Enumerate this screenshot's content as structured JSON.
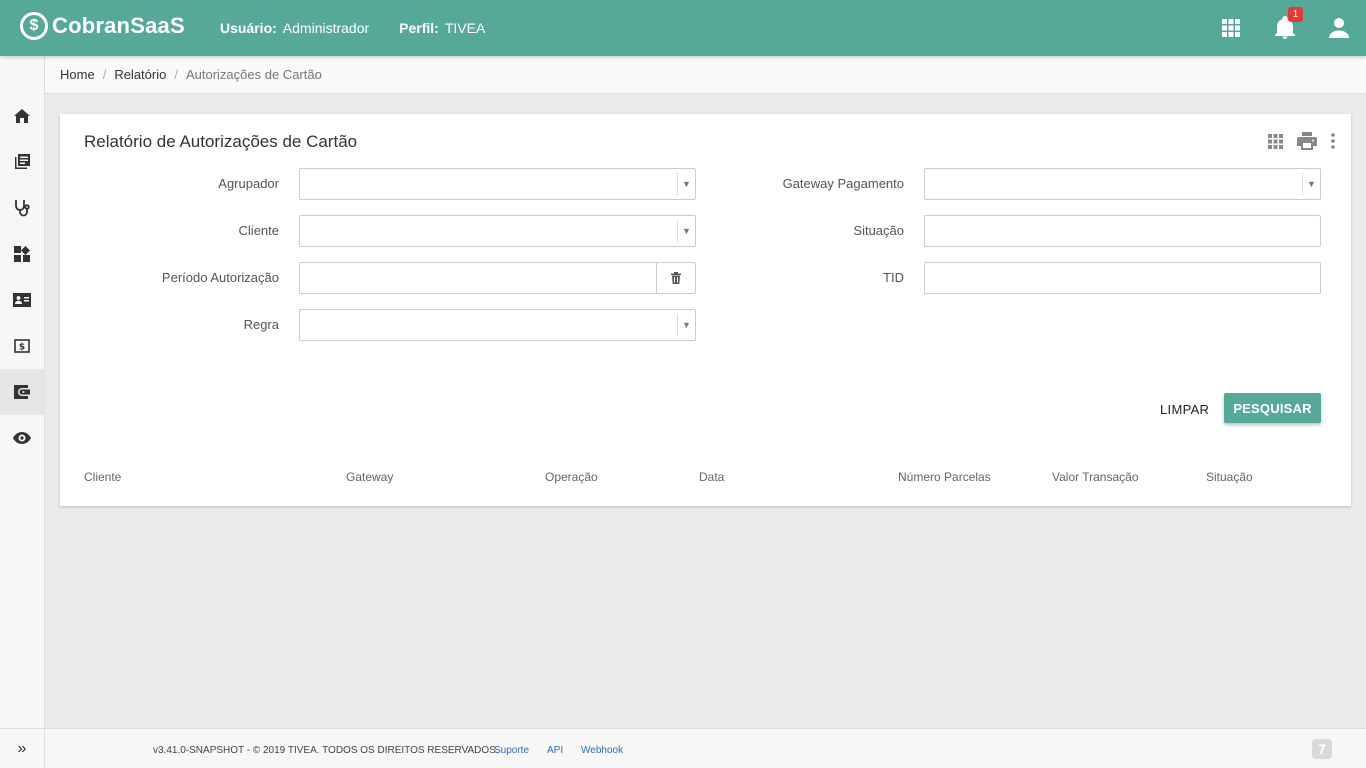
{
  "app": {
    "logo_text": "CobranSaaS",
    "logo_mark": "$"
  },
  "header": {
    "user_label": "Usuário:",
    "user_value": "Administrador",
    "profile_label": "Perfil:",
    "profile_value": "TIVEA",
    "notification_count": "1",
    "icons": [
      "apps-grid-icon",
      "bell-icon",
      "account-icon"
    ]
  },
  "sidebar": {
    "items": [
      {
        "icon": "home-icon"
      },
      {
        "icon": "library-books-icon"
      },
      {
        "icon": "stethoscope-icon"
      },
      {
        "icon": "dashboard-add-icon"
      },
      {
        "icon": "contact-card-icon"
      },
      {
        "icon": "money-bill-icon"
      },
      {
        "icon": "wallet-icon",
        "active": true
      },
      {
        "icon": "eye-icon"
      }
    ],
    "expand_label": "»"
  },
  "breadcrumb": {
    "items": [
      "Home",
      "Relatório",
      "Autorizações de Cartão"
    ],
    "separator": "/"
  },
  "card": {
    "title": "Relatório de Autorizações de Cartão",
    "tools": [
      "grid-icon",
      "print-icon",
      "more-vert-icon"
    ]
  },
  "form": {
    "left": [
      {
        "label": "Agrupador",
        "value": "",
        "type": "select"
      },
      {
        "label": "Cliente",
        "value": "",
        "type": "select"
      },
      {
        "label": "Período Autorização",
        "value": "",
        "type": "date-range"
      },
      {
        "label": "Regra",
        "value": "",
        "type": "select"
      }
    ],
    "right": [
      {
        "label": "Gateway Pagamento",
        "value": "",
        "type": "select"
      },
      {
        "label": "Situação",
        "value": "",
        "type": "text"
      },
      {
        "label": "TID",
        "value": "",
        "type": "text"
      }
    ],
    "clear_label": "LIMPAR",
    "search_label": "PESQUISAR"
  },
  "table": {
    "columns": [
      "Cliente",
      "Gateway",
      "Operação",
      "Data",
      "Número Parcelas",
      "Valor Transação",
      "Situação"
    ],
    "rows": []
  },
  "footer": {
    "copyright": "v3.41.0-SNAPSHOT - © 2019 TIVEA. TODOS OS DIREITOS RESERVADOS.",
    "links": [
      "Suporte",
      "API",
      "Webhook"
    ],
    "logo_glyph": "7"
  },
  "colors": {
    "primary": "#56a898",
    "badge": "#e53935",
    "link": "#2f6db5"
  }
}
